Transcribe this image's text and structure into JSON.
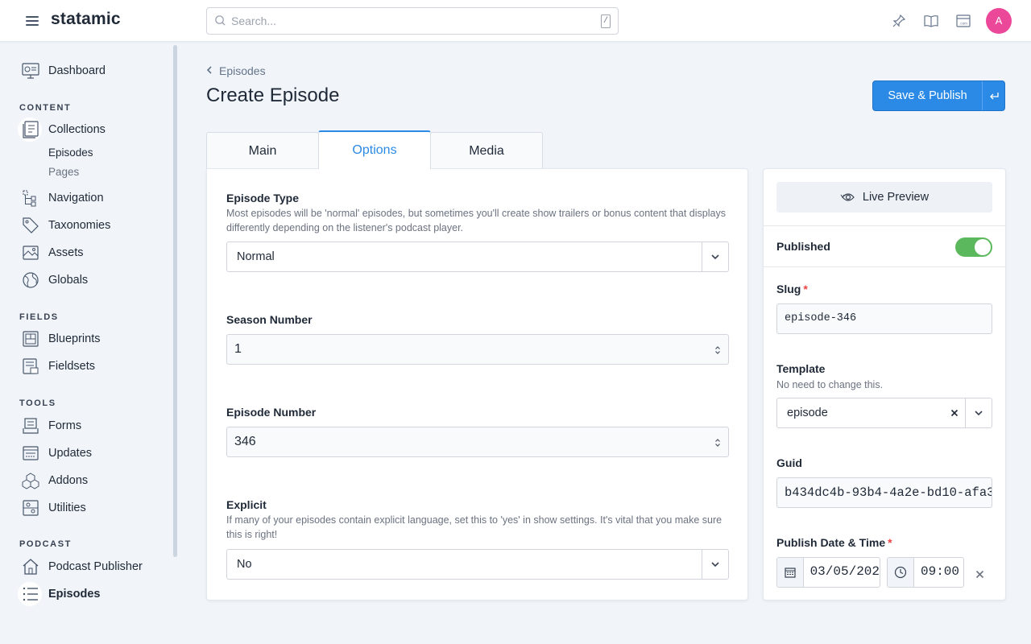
{
  "topbar": {
    "brand": "statamic",
    "search_placeholder": "Search...",
    "search_shortcut": "/",
    "icons": [
      "pin-icon",
      "book-icon",
      "site-icon"
    ],
    "avatar_initial": "A"
  },
  "sidebar": {
    "dashboard": "Dashboard",
    "sections": {
      "content": "CONTENT",
      "fields": "FIELDS",
      "tools": "TOOLS",
      "podcast": "PODCAST"
    },
    "content_items": {
      "collections": "Collections",
      "episodes": "Episodes",
      "pages": "Pages",
      "navigation": "Navigation",
      "taxonomies": "Taxonomies",
      "assets": "Assets",
      "globals": "Globals"
    },
    "fields_items": {
      "blueprints": "Blueprints",
      "fieldsets": "Fieldsets"
    },
    "tools_items": {
      "forms": "Forms",
      "updates": "Updates",
      "addons": "Addons",
      "utilities": "Utilities"
    },
    "podcast_items": {
      "publisher": "Podcast Publisher",
      "episodes": "Episodes"
    }
  },
  "header": {
    "breadcrumb": "Episodes",
    "title": "Create Episode",
    "save_label": "Save & Publish"
  },
  "tabs": [
    "Main",
    "Options",
    "Media"
  ],
  "active_tab": "Options",
  "options": {
    "episode_type": {
      "label": "Episode Type",
      "help": "Most episodes will be 'normal' episodes, but sometimes you'll create show trailers or bonus content that displays differently depending on the listener's podcast player.",
      "value": "Normal"
    },
    "season_number": {
      "label": "Season Number",
      "value": "1"
    },
    "episode_number": {
      "label": "Episode Number",
      "value": "346"
    },
    "explicit": {
      "label": "Explicit",
      "help": "If many of your episodes contain explicit language, set this to 'yes' in show settings. It's vital that you make sure this is right!",
      "value": "No"
    }
  },
  "side": {
    "live_preview": "Live Preview",
    "published_label": "Published",
    "published": true,
    "slug": {
      "label": "Slug",
      "required": "*",
      "value": "episode-346"
    },
    "template": {
      "label": "Template",
      "help": "No need to change this.",
      "value": "episode"
    },
    "guid": {
      "label": "Guid",
      "value": "b434dc4b-93b4-4a2e-bd10-afa3"
    },
    "publish": {
      "label": "Publish Date & Time",
      "required": "*",
      "date": "03/05/202",
      "time": "09:00"
    }
  },
  "colors": {
    "accent": "#2b8ae6",
    "toggle_on": "#5cb85c",
    "avatar": "#ec4899",
    "required": "#ef4444"
  }
}
